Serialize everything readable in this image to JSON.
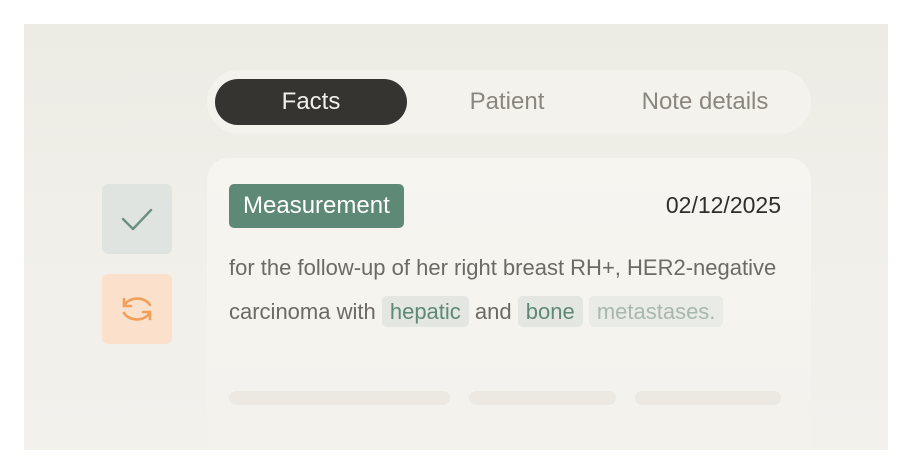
{
  "tabs": [
    {
      "label": "Facts",
      "active": true
    },
    {
      "label": "Patient",
      "active": false
    },
    {
      "label": "Note details",
      "active": false
    }
  ],
  "actions": {
    "confirm_icon": "check-icon",
    "refresh_icon": "sync-icon"
  },
  "card": {
    "badge": "Measurement",
    "date": "02/12/2025",
    "text_before": "for the follow-up of her right breast RH+, HER2-negative carcinoma with ",
    "highlight_1": "hepatic",
    "text_middle": " and ",
    "highlight_2": "bone",
    "text_space": " ",
    "highlight_3": "metastases."
  },
  "colors": {
    "accent": "#5f8977",
    "tab_active_bg": "#353431",
    "refresh_bg": "#fbe1cb",
    "refresh_icon": "#f0a05a"
  }
}
